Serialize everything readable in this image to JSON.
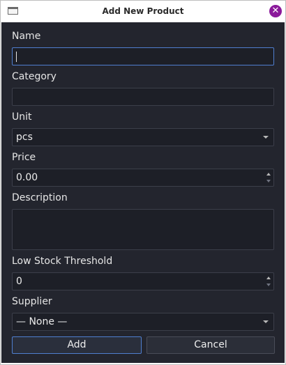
{
  "window": {
    "title": "Add New Product"
  },
  "form": {
    "name_label": "Name",
    "name_value": "",
    "category_label": "Category",
    "category_value": "",
    "unit_label": "Unit",
    "unit_value": "pcs",
    "price_label": "Price",
    "price_value": "0.00",
    "description_label": "Description",
    "description_value": "",
    "low_stock_label": "Low Stock Threshold",
    "low_stock_value": "0",
    "supplier_label": "Supplier",
    "supplier_value": "— None —"
  },
  "buttons": {
    "add_label": "Add",
    "cancel_label": "Cancel"
  },
  "icons": {
    "close": "close-icon",
    "app": "window-icon"
  },
  "colors": {
    "accent": "#4f7fd0",
    "close": "#8b1a9b",
    "background": "#23252e"
  }
}
